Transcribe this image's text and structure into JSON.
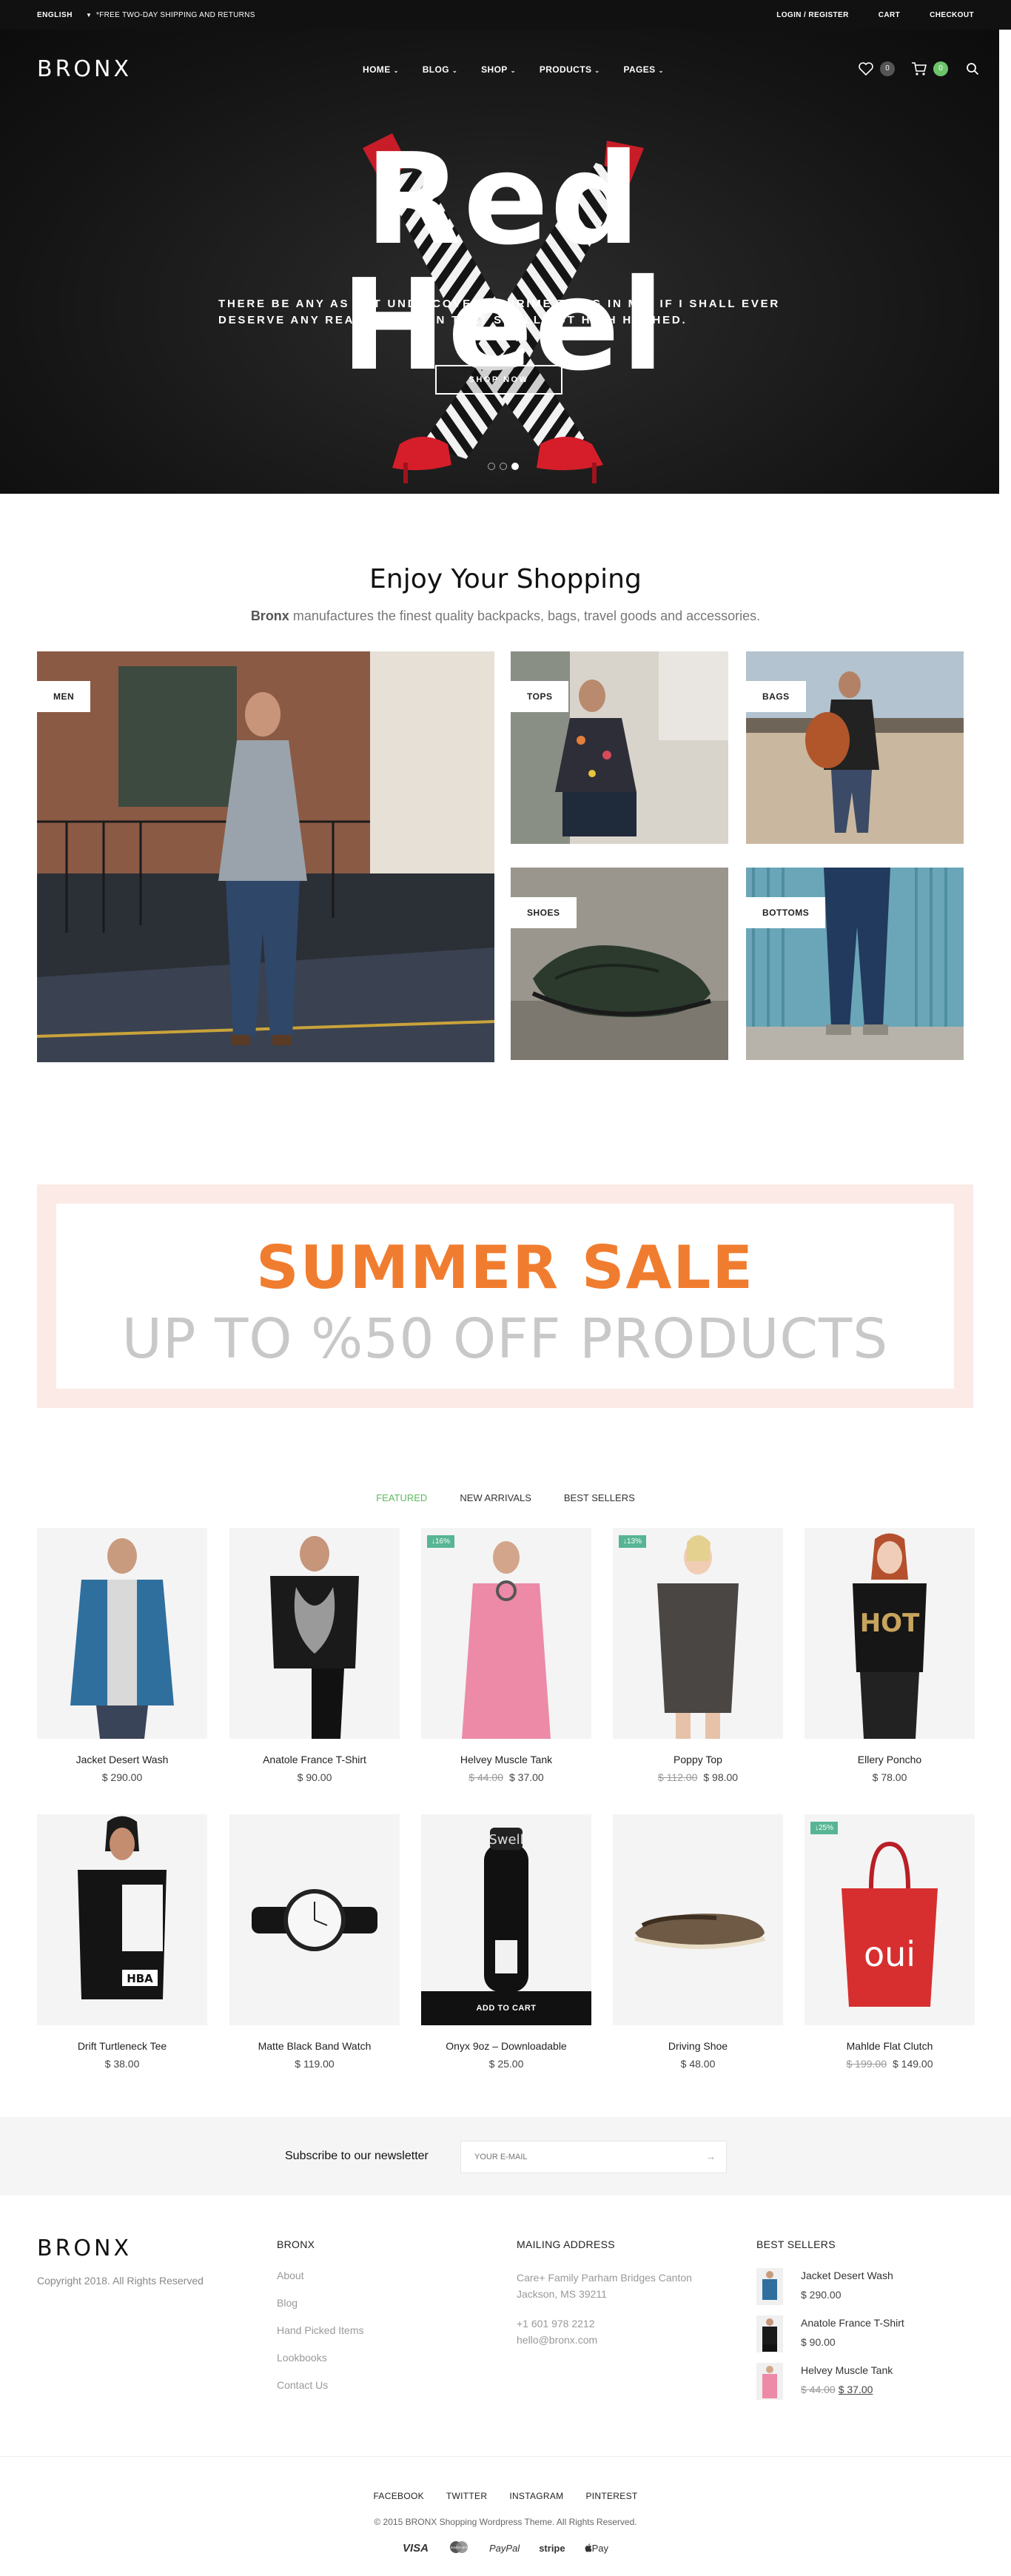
{
  "topbar": {
    "language": "ENGLISH",
    "promo": "*FREE TWO-DAY SHIPPING AND RETURNS",
    "links": [
      "LOGIN / REGISTER",
      "CART",
      "CHECKOUT"
    ]
  },
  "header": {
    "logo": "BRONX",
    "menu": [
      "HOME",
      "BLOG",
      "SHOP",
      "PRODUCTS",
      "PAGES"
    ],
    "wishlist_count": "0",
    "cart_count": "0"
  },
  "hero": {
    "title": "Red Heel",
    "subtitle": "THERE BE ANY AS YET UNDISCOVERED PRIME THING IN ME; IF I SHALL EVER DESERVE ANY REAL REPUTE IN THAT SMALL BUT HIGH HUSHED.",
    "button": "SHOP NOW",
    "slides": 3,
    "active_slide": 3
  },
  "categories": {
    "title": "Enjoy Your Shopping",
    "subtitle_brand": "Bronx",
    "subtitle_rest": " manufactures the finest quality backpacks, bags, travel goods and accessories.",
    "tiles": [
      "MEN",
      "TOPS",
      "BAGS",
      "SHOES",
      "BOTTOMS"
    ]
  },
  "sale": {
    "line1": "SUMMER SALE",
    "line2": "UP TO %50 OFF PRODUCTS"
  },
  "product_tabs": [
    "FEATURED",
    "NEW ARRIVALS",
    "BEST SELLERS"
  ],
  "products": [
    {
      "name": "Jacket Desert Wash",
      "price": "$ 290.00",
      "old_price": "",
      "badge": ""
    },
    {
      "name": "Anatole France T-Shirt",
      "price": "$ 90.00",
      "old_price": "",
      "badge": ""
    },
    {
      "name": "Helvey Muscle Tank",
      "price": "$ 37.00",
      "old_price": "$ 44.00",
      "badge": "↓16%"
    },
    {
      "name": "Poppy Top",
      "price": "$ 98.00",
      "old_price": "$ 112.00",
      "badge": "↓13%"
    },
    {
      "name": "Ellery Poncho",
      "price": "$ 78.00",
      "old_price": "",
      "badge": ""
    },
    {
      "name": "Drift Turtleneck Tee",
      "price": "$ 38.00",
      "old_price": "",
      "badge": ""
    },
    {
      "name": "Matte Black Band Watch",
      "price": "$ 119.00",
      "old_price": "",
      "badge": ""
    },
    {
      "name": "Onyx 9oz – Downloadable",
      "price": "$ 25.00",
      "old_price": "",
      "badge": "",
      "cart_label": "ADD TO CART"
    },
    {
      "name": "Driving Shoe",
      "price": "$ 48.00",
      "old_price": "",
      "badge": ""
    },
    {
      "name": "Mahlde Flat Clutch",
      "price": "$ 149.00",
      "old_price": "$ 199.00",
      "badge": "↓25%"
    }
  ],
  "newsletter": {
    "label": "Subscribe to our newsletter",
    "placeholder": "YOUR E-MAIL",
    "arrow": "→"
  },
  "footer": {
    "logo": "BRONX",
    "copyright": "Copyright 2018. All Rights Reserved",
    "col_bronx_title": "BRONX",
    "col_bronx_links": [
      "About",
      "Blog",
      "Hand Picked Items",
      "Lookbooks",
      "Contact Us"
    ],
    "address_title": "MAILING ADDRESS",
    "address_line1": "Care+ Family Parham Bridges Canton",
    "address_line2": "Jackson, MS 39211",
    "phone": "+1 601 978 2212",
    "email": "hello@bronx.com",
    "best_title": "BEST SELLERS",
    "best_sellers": [
      {
        "name": "Jacket Desert Wash",
        "price": "$ 290.00",
        "old_price": ""
      },
      {
        "name": "Anatole France T-Shirt",
        "price": "$ 90.00",
        "old_price": ""
      },
      {
        "name": "Helvey Muscle Tank",
        "price": "$ 37.00",
        "old_price": "$ 44.00"
      }
    ],
    "social": [
      "FACEBOOK",
      "TWITTER",
      "INSTAGRAM",
      "PINTEREST"
    ],
    "bottom_copyright": "© 2015 BRONX Shopping Wordpress Theme. All Rights Reserved.",
    "payments": [
      "VISA",
      "mastercard",
      "PayPal",
      "stripe",
      "Pay"
    ]
  },
  "colors": {
    "accent_green": "#5cb85c",
    "sale_orange": "#f07d2f",
    "badge_teal": "#57b594",
    "hero_red": "#d61e2a"
  }
}
